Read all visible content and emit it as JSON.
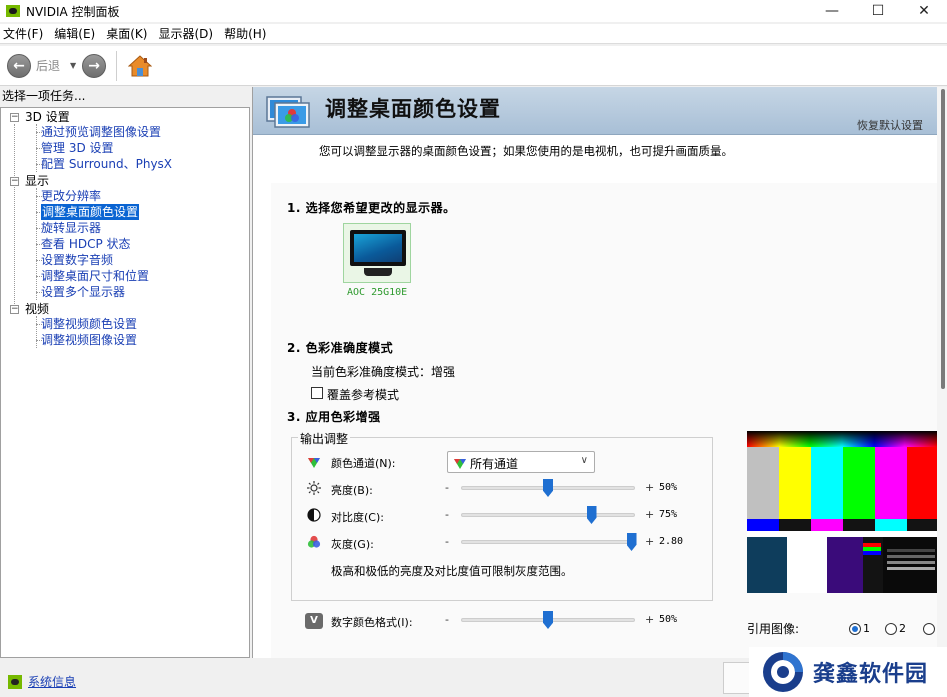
{
  "window": {
    "title": "NVIDIA 控制面板",
    "minimize": "—",
    "maximize": "☐",
    "close": "✕"
  },
  "menu": [
    "文件(F)",
    "编辑(E)",
    "桌面(K)",
    "显示器(D)",
    "帮助(H)"
  ],
  "toolbar": {
    "back_label": "后退"
  },
  "left": {
    "task_header": "选择一项任务...",
    "tree": {
      "group_3d": "3D 设置",
      "items_3d": [
        "通过预览调整图像设置",
        "管理 3D 设置",
        "配置 Surround、PhysX"
      ],
      "group_display": "显示",
      "items_display": [
        "更改分辨率",
        "调整桌面颜色设置",
        "旋转显示器",
        "查看 HDCP 状态",
        "设置数字音频",
        "调整桌面尺寸和位置",
        "设置多个显示器"
      ],
      "group_video": "视频",
      "items_video": [
        "调整视频颜色设置",
        "调整视频图像设置"
      ]
    },
    "system_info": "系统信息"
  },
  "page": {
    "title": "调整桌面颜色设置",
    "restore_defaults": "恢复默认设置",
    "intro": "您可以调整显示器的桌面颜色设置；如果您使用的是电视机，也可提升画面质量。",
    "section1": "1. 选择您希望更改的显示器。",
    "monitor_name": "AOC 25G10E",
    "section2": "2. 色彩准确度模式",
    "accuracy_mode": "当前色彩准确度模式：增强",
    "override_ref": "覆盖参考模式",
    "section3": "3. 应用色彩增强",
    "output_group": "输出调整",
    "channel_label": "颜色通道(N):",
    "channel_value": "所有通道",
    "brightness_label": "亮度(B):",
    "brightness_value": "50%",
    "contrast_label": "对比度(C):",
    "contrast_value": "75%",
    "gamma_label": "灰度(G):",
    "gamma_value": "2.80",
    "range_note": "极高和极低的亮度及对比度值可限制灰度范围。",
    "digital_vibrance_label": "数字颜色格式(I):",
    "digital_vibrance_value": "50%",
    "reference_image_label": "引用图像:",
    "radio_1": "1",
    "radio_2": "2",
    "minus": "-",
    "plus": "+"
  },
  "sliders": {
    "brightness": 0.5,
    "contrast": 0.75,
    "gamma": 0.98,
    "digital_vibrance": 0.5
  },
  "watermark": "龚鑫软件园"
}
